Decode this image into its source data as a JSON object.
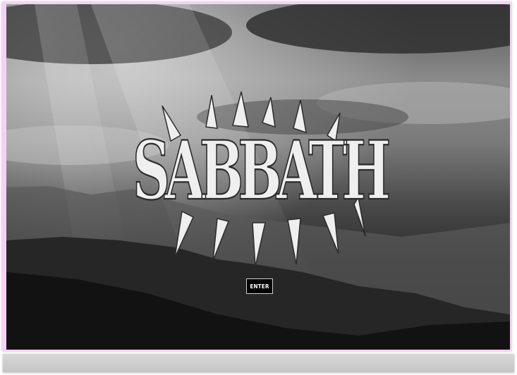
{
  "page": {
    "logo_text": "SABBATH",
    "enter_label": "ENTER"
  },
  "colors": {
    "frame_border": "#f3d3f3",
    "button_bg": "#000000",
    "button_border": "#cfcfcf",
    "logo_fill": "#efefef"
  },
  "icons": {
    "logo": "metal-logo-icon"
  }
}
